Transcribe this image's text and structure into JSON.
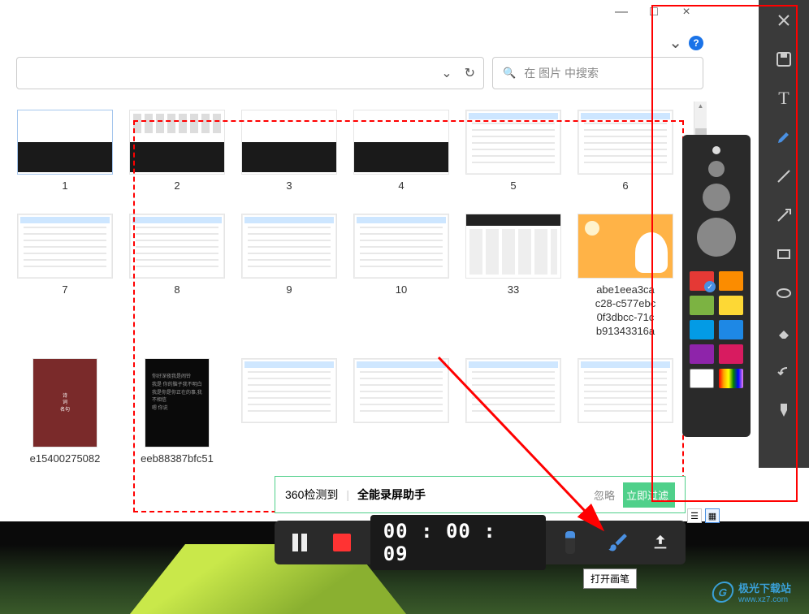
{
  "window": {
    "minimize": "—",
    "maximize": "□",
    "close": "×"
  },
  "header": {
    "chevron": "⌄",
    "help": "?"
  },
  "addressBar": {
    "dropdown": "⌄",
    "refresh": "↻"
  },
  "search": {
    "icon": "🔍",
    "placeholder": "在 图片 中搜索"
  },
  "thumbnails": [
    {
      "label": "1",
      "type": "dark-half",
      "selected": true
    },
    {
      "label": "2",
      "type": "dark-grid"
    },
    {
      "label": "3",
      "type": "dark-half"
    },
    {
      "label": "4",
      "type": "dark-half"
    },
    {
      "label": "5",
      "type": "doc"
    },
    {
      "label": "6",
      "type": "doc"
    },
    {
      "label": "7",
      "type": "doc"
    },
    {
      "label": "8",
      "type": "doc"
    },
    {
      "label": "9",
      "type": "doc"
    },
    {
      "label": "10",
      "type": "doc"
    },
    {
      "label": "33",
      "type": "dark-top"
    },
    {
      "label": "abe1eea3ca\nc28-c577ebc\n0f3dbcc-71c\nb91343316a",
      "type": "cartoon"
    },
    {
      "label": "e15400275082",
      "type": "red"
    },
    {
      "label": "eeb88387bfc51",
      "type": "black"
    }
  ],
  "extra_thumbs": [
    "",
    "",
    "",
    ""
  ],
  "notification": {
    "prefix": "360检测到",
    "title": "全能录屏助手",
    "ignore": "忽略",
    "action": "立即过滤"
  },
  "recorder": {
    "time": "00 : 00 : 09"
  },
  "tooltip": "打开画笔",
  "toolbar": {
    "items": [
      "close",
      "save",
      "text",
      "pen",
      "line",
      "arrow",
      "rect",
      "ellipse",
      "eraser",
      "undo",
      "brush"
    ]
  },
  "colorPanel": {
    "sizes": [
      10,
      20,
      34,
      48
    ],
    "selectedSize": 0,
    "colors": [
      "#e53935",
      "#fb8c00",
      "#7cb342",
      "#fdd835",
      "#039be5",
      "#1e88e5",
      "#8e24aa",
      "#d81b60",
      "#ffffff",
      "rainbow"
    ],
    "selectedColor": 0
  },
  "watermark": {
    "text": "极光下载站",
    "url": "www.xz7.com"
  }
}
